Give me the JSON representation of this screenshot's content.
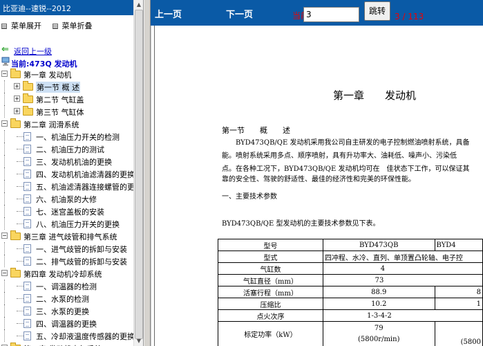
{
  "left_panel": {
    "title": "比亚迪--速锐--2012",
    "menu_expand": "菜单展开",
    "menu_collapse": "菜单折叠",
    "back_link": "返回上一级",
    "current": "当前:473Q 发动机",
    "tree": [
      {
        "level": 0,
        "type": "folder",
        "label": "第一章 发动机",
        "open": true
      },
      {
        "level": 1,
        "type": "folder",
        "label": "第一节 概 述",
        "open": false,
        "selected": true
      },
      {
        "level": 1,
        "type": "folder",
        "label": "第二节 气缸盖",
        "open": false
      },
      {
        "level": 1,
        "type": "folder",
        "label": "第三节 气缸体",
        "open": false
      },
      {
        "level": 0,
        "type": "folder",
        "label": "第二章 润滑系统",
        "open": true
      },
      {
        "level": 1,
        "type": "doc",
        "label": "一、机油压力开关的检测"
      },
      {
        "level": 1,
        "type": "doc",
        "label": "二、机油压力的测试"
      },
      {
        "level": 1,
        "type": "doc",
        "label": "三、发动机机油的更换"
      },
      {
        "level": 1,
        "type": "doc",
        "label": "四、发动机机油滤清器的更换"
      },
      {
        "level": 1,
        "type": "doc",
        "label": "五、机油滤清器连接螺管的更换"
      },
      {
        "level": 1,
        "type": "doc",
        "label": "六、机油泵的大修"
      },
      {
        "level": 1,
        "type": "doc",
        "label": "七、迷宫盖板的安装"
      },
      {
        "level": 1,
        "type": "doc",
        "label": "八、机油压力开关的更换"
      },
      {
        "level": 0,
        "type": "folder",
        "label": "第三章 进气歧管和排气系统",
        "open": true
      },
      {
        "level": 1,
        "type": "doc",
        "label": "一、进气歧管的拆卸与安装"
      },
      {
        "level": 1,
        "type": "doc",
        "label": "二、排气歧管的拆卸与安装"
      },
      {
        "level": 0,
        "type": "folder",
        "label": "第四章 发动机冷却系统",
        "open": true
      },
      {
        "level": 1,
        "type": "doc",
        "label": "一、调温器的检测"
      },
      {
        "level": 1,
        "type": "doc",
        "label": "二、水泵的检测"
      },
      {
        "level": 1,
        "type": "doc",
        "label": "三、水泵的更换"
      },
      {
        "level": 1,
        "type": "doc",
        "label": "四、调温器的更换"
      },
      {
        "level": 1,
        "type": "doc",
        "label": "五、冷却液温度传感器的更换"
      },
      {
        "level": 0,
        "type": "folder",
        "label": "第五章 发动机电气系统",
        "open": false
      }
    ]
  },
  "toolbar": {
    "prev": "上一页",
    "next": "下一页",
    "current_label": "当前为",
    "page_value": "3",
    "jump": "跳转",
    "page_count": "3 / 113"
  },
  "document": {
    "chapter_title": "第一章　　发动机",
    "section_title": "第一节　　概　　述",
    "paragraph_lines": [
      "　　BYD473QB/QE 发动机采用我公司自主研发的电子控制燃油喷射系统，具备",
      "能。喷射系统采用多点、顺序喷射，具有升功率大、油耗低、噪声小、污染低",
      "点。在各种工况下，BYD473QB/QE 发动机均可在　佳状态下工作，可以保证其",
      "靠的安全性、驾驶的舒适性、最佳的经济性和完美的环保性能。"
    ],
    "subheading": "一、主要技术参数",
    "table_intro": "BYD473QB/QE 型发动机的主要技术参数见下表。",
    "table": [
      [
        "型号",
        "BYD473QB",
        "BYD4"
      ],
      [
        "型式",
        "四冲程、水冷、直列、单顶置凸轮轴、电子控",
        ""
      ],
      [
        "气缸数",
        "4",
        ""
      ],
      [
        "气缸直径（mm）",
        "73",
        ""
      ],
      [
        "活塞行程（mm）",
        "88.9",
        "8"
      ],
      [
        "压缩比",
        "10.2",
        "1"
      ],
      [
        "点火次序",
        "1-3-4-2",
        ""
      ],
      [
        "标定功率（kW）",
        "79",
        "(5800"
      ]
    ],
    "table_extra_line": "(5800r/min)"
  }
}
